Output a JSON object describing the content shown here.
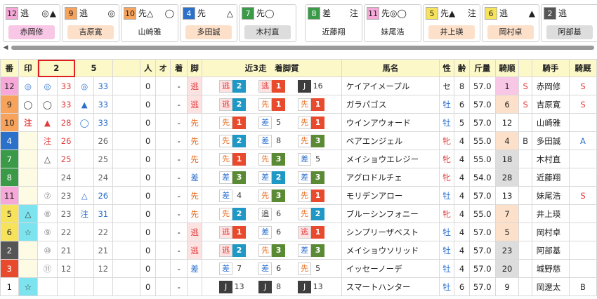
{
  "styles": {
    "逃": {
      "color": "#e23a3a",
      "bg": "#fde2e2"
    },
    "先": {
      "color": "#e86a1a",
      "bg": "#ffffff"
    },
    "差": {
      "color": "#2a6fd0",
      "bg": "#ffffff"
    },
    "追": {
      "color": "#333333",
      "bg": "#ffffff"
    },
    "J": {
      "color": "#ffffff",
      "bg": "#3d3d3d"
    }
  },
  "rank_colors": {
    "1": "#e84a2e",
    "2": "#1f98c5",
    "3": "#5a8a34",
    "4": "#ffffff",
    "5": "#ffffff",
    "7": "#ffffff",
    "8": "#ffffff",
    "13": "#ffffff",
    "16": "#ffffff"
  },
  "mark_colors": {
    "◎": "#2a6fd0",
    "◯": "#333333",
    "▲": "#e23a3a",
    "△": "#333333",
    "注": "#e23a3a",
    "☆": "#333333"
  },
  "cards": [
    {
      "num": "12",
      "style": "逃",
      "marks": "◎▲",
      "name": "赤岡修",
      "num_bg": "#f6a9d8",
      "name_bg": "#f9c7e6"
    },
    {
      "num": "9",
      "style": "逃",
      "marks": "◎",
      "name": "吉原寛",
      "num_bg": "#f7a35c",
      "name_bg": "#fde0ca"
    },
    {
      "num": "10",
      "style": "先△",
      "marks": "◯",
      "name": "山崎雅",
      "num_bg": "#f7a35c",
      "name_bg": "#ffffff"
    },
    {
      "num": "4",
      "style": "先",
      "marks": "△",
      "name": "多田誠",
      "num_bg": "#2b71c9",
      "name_bg": "#fde0ca"
    },
    {
      "num": "7",
      "style": "先◯",
      "marks": "",
      "name": "木村直",
      "num_bg": "#3a9a48",
      "name_bg": "#dddddd"
    },
    {
      "num": "8",
      "style": "差",
      "marks": "注",
      "name": "近藤翔",
      "num_bg": "#3a9a48",
      "name_bg": "#ffffff"
    },
    {
      "num": "11",
      "style": "先◎◯",
      "marks": "",
      "name": "妹尾浩",
      "num_bg": "#f6a9d8",
      "name_bg": "#ffffff"
    },
    {
      "num": "5",
      "style": "先▲",
      "marks": "注",
      "name": "井上瑛",
      "num_bg": "#f7e25c",
      "name_bg": "#fde0ca"
    },
    {
      "num": "6",
      "style": "逃",
      "marks": "▲",
      "name": "岡村卓",
      "num_bg": "#f7e25c",
      "name_bg": "#fde0ca"
    },
    {
      "num": "2",
      "style": "逃",
      "marks": "",
      "name": "阿部基",
      "num_bg": "#555555",
      "name_bg": "#dddddd"
    }
  ],
  "headers": {
    "ban": "番",
    "mark": "印",
    "col2": "2",
    "col5": "5",
    "ninki": "人",
    "o": "オ",
    "chaku": "着",
    "ashi": "脚",
    "recent": "近3走　着脚質",
    "horse": "馬名",
    "sex": "性",
    "age": "齢",
    "weight": "斤量",
    "order": "騎順",
    "jockey": "騎手",
    "stable": "騎厩"
  },
  "rows": [
    {
      "ban": "12",
      "ban_bg": "#f6a9d8",
      "mark": "◎",
      "mark_bg": "#ffffff",
      "c2m": "◎",
      "c2v": "33",
      "c5m": "◎",
      "c5v": "33",
      "ninki": "0",
      "chaku": "-",
      "ashi": "逃",
      "r1s": "逃",
      "r1n": "2",
      "r2s": "逃",
      "r2n": "1",
      "r3s": "J",
      "r3n": "16",
      "horse": "ケイアイメープル",
      "sex": "セ",
      "age": "8",
      "weight": "57.0",
      "order": "1",
      "order_bg": "#f9c7e6",
      "s1": "S",
      "jockey": "赤岡修",
      "stable": "S"
    },
    {
      "ban": "9",
      "ban_bg": "#f7a35c",
      "mark": "◯",
      "mark_bg": "#ffffff",
      "c2m": "◯",
      "c2v": "33",
      "c5m": "▲",
      "c5v": "33",
      "ninki": "0",
      "chaku": "-",
      "ashi": "逃",
      "r1s": "逃",
      "r1n": "2",
      "r2s": "先",
      "r2n": "1",
      "r3s": "先",
      "r3n": "1",
      "horse": "ガラパゴス",
      "sex": "牡",
      "age": "6",
      "weight": "57.0",
      "order": "6",
      "order_bg": "#fde0ca",
      "s1": "S",
      "jockey": "吉原寛",
      "stable": "S"
    },
    {
      "ban": "10",
      "ban_bg": "#f7a35c",
      "mark": "注",
      "mark_bg": "#ffffff",
      "c2m": "▲",
      "c2v": "28",
      "c5m": "◯",
      "c5v": "33",
      "ninki": "0",
      "chaku": "-",
      "ashi": "先",
      "r1s": "先",
      "r1n": "1",
      "r2s": "差",
      "r2n": "5",
      "r3s": "先",
      "r3n": "1",
      "horse": "ウインアウォード",
      "sex": "牡",
      "age": "5",
      "weight": "57.0",
      "order": "12",
      "order_bg": "#ffffff",
      "s1": "",
      "jockey": "山崎雅",
      "stable": ""
    },
    {
      "ban": "4",
      "ban_bg": "#2b71c9",
      "mark": "",
      "mark_bg": "#fdfbe4",
      "c2m": "注",
      "c2v": "26",
      "c5m": "",
      "c5v": "26",
      "ninki": "0",
      "chaku": "-",
      "ashi": "先",
      "r1s": "先",
      "r1n": "2",
      "r2s": "差",
      "r2n": "8",
      "r3s": "先",
      "r3n": "3",
      "horse": "ベアエンジェル",
      "sex": "牝",
      "age": "4",
      "weight": "55.0",
      "order": "4",
      "order_bg": "#fde0ca",
      "s1": "B",
      "jockey": "多田誠",
      "stable": "A"
    },
    {
      "ban": "7",
      "ban_bg": "#3a9a48",
      "mark": "",
      "mark_bg": "#fdfbe4",
      "c2m": "△",
      "c2v": "25",
      "c5m": "",
      "c5v": "25",
      "ninki": "0",
      "chaku": "-",
      "ashi": "先",
      "r1s": "先",
      "r1n": "1",
      "r2s": "先",
      "r2n": "3",
      "r3s": "差",
      "r3n": "5",
      "horse": "メイショウエレジー",
      "sex": "牝",
      "age": "4",
      "weight": "55.0",
      "order": "18",
      "order_bg": "#dddddd",
      "s1": "",
      "jockey": "木村直",
      "stable": ""
    },
    {
      "ban": "8",
      "ban_bg": "#3a9a48",
      "mark": "",
      "mark_bg": "#fdfbe4",
      "c2m": "",
      "c2v": "24",
      "c5m": "",
      "c5v": "24",
      "ninki": "0",
      "chaku": "-",
      "ashi": "差",
      "r1s": "差",
      "r1n": "3",
      "r2s": "差",
      "r2n": "2",
      "r3s": "差",
      "r3n": "3",
      "horse": "アグロドルチェ",
      "sex": "牝",
      "age": "4",
      "weight": "54.0",
      "order": "28",
      "order_bg": "#dddddd",
      "s1": "",
      "jockey": "近藤翔",
      "stable": ""
    },
    {
      "ban": "11",
      "ban_bg": "#f6a9d8",
      "mark": "",
      "mark_bg": "#fdfbe4",
      "c2m": "⑦",
      "c2v": "23",
      "c5m": "△",
      "c5v": "26",
      "ninki": "0",
      "chaku": "-",
      "ashi": "先",
      "r1s": "差",
      "r1n": "4",
      "r2s": "先",
      "r2n": "3",
      "r3s": "先",
      "r3n": "1",
      "horse": "モリデンアロー",
      "sex": "牡",
      "age": "4",
      "weight": "57.0",
      "order": "13",
      "order_bg": "#ffffff",
      "s1": "",
      "jockey": "妹尾浩",
      "stable": "S"
    },
    {
      "ban": "5",
      "ban_bg": "#f7e25c",
      "mark": "△",
      "mark_bg": "#7de4ef",
      "c2m": "⑧",
      "c2v": "23",
      "c5m": "注",
      "c5v": "31",
      "ninki": "0",
      "chaku": "-",
      "ashi": "先",
      "r1s": "先",
      "r1n": "2",
      "r2s": "追",
      "r2n": "6",
      "r3s": "先",
      "r3n": "2",
      "horse": "ブルーシンフォニー",
      "sex": "牝",
      "age": "4",
      "weight": "55.0",
      "order": "7",
      "order_bg": "#fde0ca",
      "s1": "",
      "jockey": "井上瑛",
      "stable": ""
    },
    {
      "ban": "6",
      "ban_bg": "#f7e25c",
      "mark": "☆",
      "mark_bg": "#7de4ef",
      "c2m": "⑨",
      "c2v": "22",
      "c5m": "",
      "c5v": "22",
      "ninki": "0",
      "chaku": "-",
      "ashi": "逃",
      "r1s": "逃",
      "r1n": "1",
      "r2s": "差",
      "r2n": "6",
      "r3s": "逃",
      "r3n": "1",
      "horse": "シンプリーザベスト",
      "sex": "牡",
      "age": "4",
      "weight": "57.0",
      "order": "5",
      "order_bg": "#fde0ca",
      "s1": "",
      "jockey": "岡村卓",
      "stable": ""
    },
    {
      "ban": "2",
      "ban_bg": "#555555",
      "mark": "",
      "mark_bg": "#fdfbe4",
      "c2m": "⑩",
      "c2v": "21",
      "c5m": "",
      "c5v": "21",
      "ninki": "0",
      "chaku": "-",
      "ashi": "逃",
      "r1s": "逃",
      "r1n": "2",
      "r2s": "先",
      "r2n": "3",
      "r3s": "差",
      "r3n": "3",
      "horse": "メイショウソリッド",
      "sex": "牡",
      "age": "4",
      "weight": "57.0",
      "order": "23",
      "order_bg": "#dddddd",
      "s1": "",
      "jockey": "阿部基",
      "stable": ""
    },
    {
      "ban": "3",
      "ban_bg": "#e84a2e",
      "mark": "",
      "mark_bg": "#fdfbe4",
      "c2m": "⑪",
      "c2v": "12",
      "c5m": "",
      "c5v": "12",
      "ninki": "0",
      "chaku": "-",
      "ashi": "差",
      "r1s": "差",
      "r1n": "7",
      "r2s": "差",
      "r2n": "6",
      "r3s": "先",
      "r3n": "5",
      "horse": "イッセーノーデ",
      "sex": "牡",
      "age": "4",
      "weight": "57.0",
      "order": "20",
      "order_bg": "#dddddd",
      "s1": "",
      "jockey": "城野慈",
      "stable": ""
    },
    {
      "ban": "1",
      "ban_bg": "#ffffff",
      "mark": "☆",
      "mark_bg": "#7de4ef",
      "c2m": "",
      "c2v": "",
      "c5m": "",
      "c5v": "",
      "ninki": "0",
      "chaku": "-",
      "ashi": "",
      "r1s": "J",
      "r1n": "13",
      "r2s": "J",
      "r2n": "8",
      "r3s": "J",
      "r3n": "13",
      "horse": "スマートハンター",
      "sex": "牡",
      "age": "6",
      "weight": "57.0",
      "order": "9",
      "order_bg": "#ffffff",
      "s1": "",
      "jockey": "岡遼太",
      "stable": "B"
    }
  ]
}
